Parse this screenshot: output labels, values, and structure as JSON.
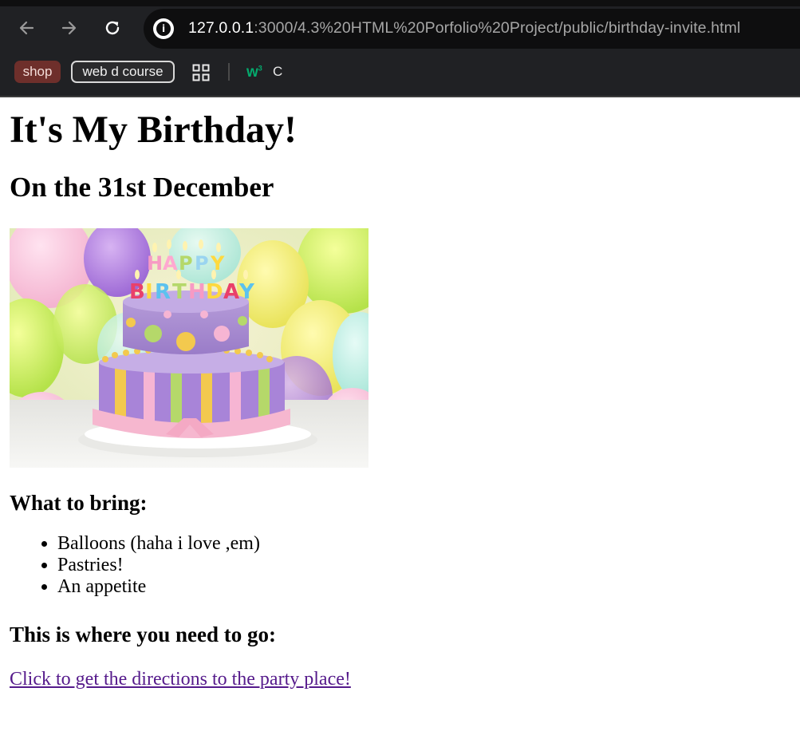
{
  "browser": {
    "url_host": "127.0.0.1",
    "url_path": ":3000/4.3%20HTML%20Porfolio%20Project/public/birthday-invite.html",
    "bookmarks": [
      {
        "label": "shop"
      },
      {
        "label": "web d course"
      }
    ],
    "bookmark_c_label": "C",
    "bookmark_w3_label": "w",
    "bookmark_w3_sup": "3",
    "icons": [
      "back-arrow-icon",
      "forward-arrow-icon",
      "reload-icon",
      "info-icon",
      "apps-grid-icon",
      "w3schools-icon"
    ]
  },
  "page": {
    "title": "It's My Birthday!",
    "date": "On the 31st December",
    "image_caption_text": [
      "HAPPY",
      "BIRTHDAY"
    ],
    "bring_heading": "What to bring:",
    "bring_items": [
      "Balloons (haha i love ,em)",
      "Pastries!",
      "An appetite"
    ],
    "where_heading": "This is where you need to go:",
    "directions_link": "Click to get the directions to the party place!"
  },
  "colors": {
    "chrome_bg": "#202124",
    "omnibox_bg": "#0e0e0f",
    "link_visited": "#551a8b",
    "w3_green": "#04aa6d",
    "shop_chip": "#6e2f2b"
  }
}
